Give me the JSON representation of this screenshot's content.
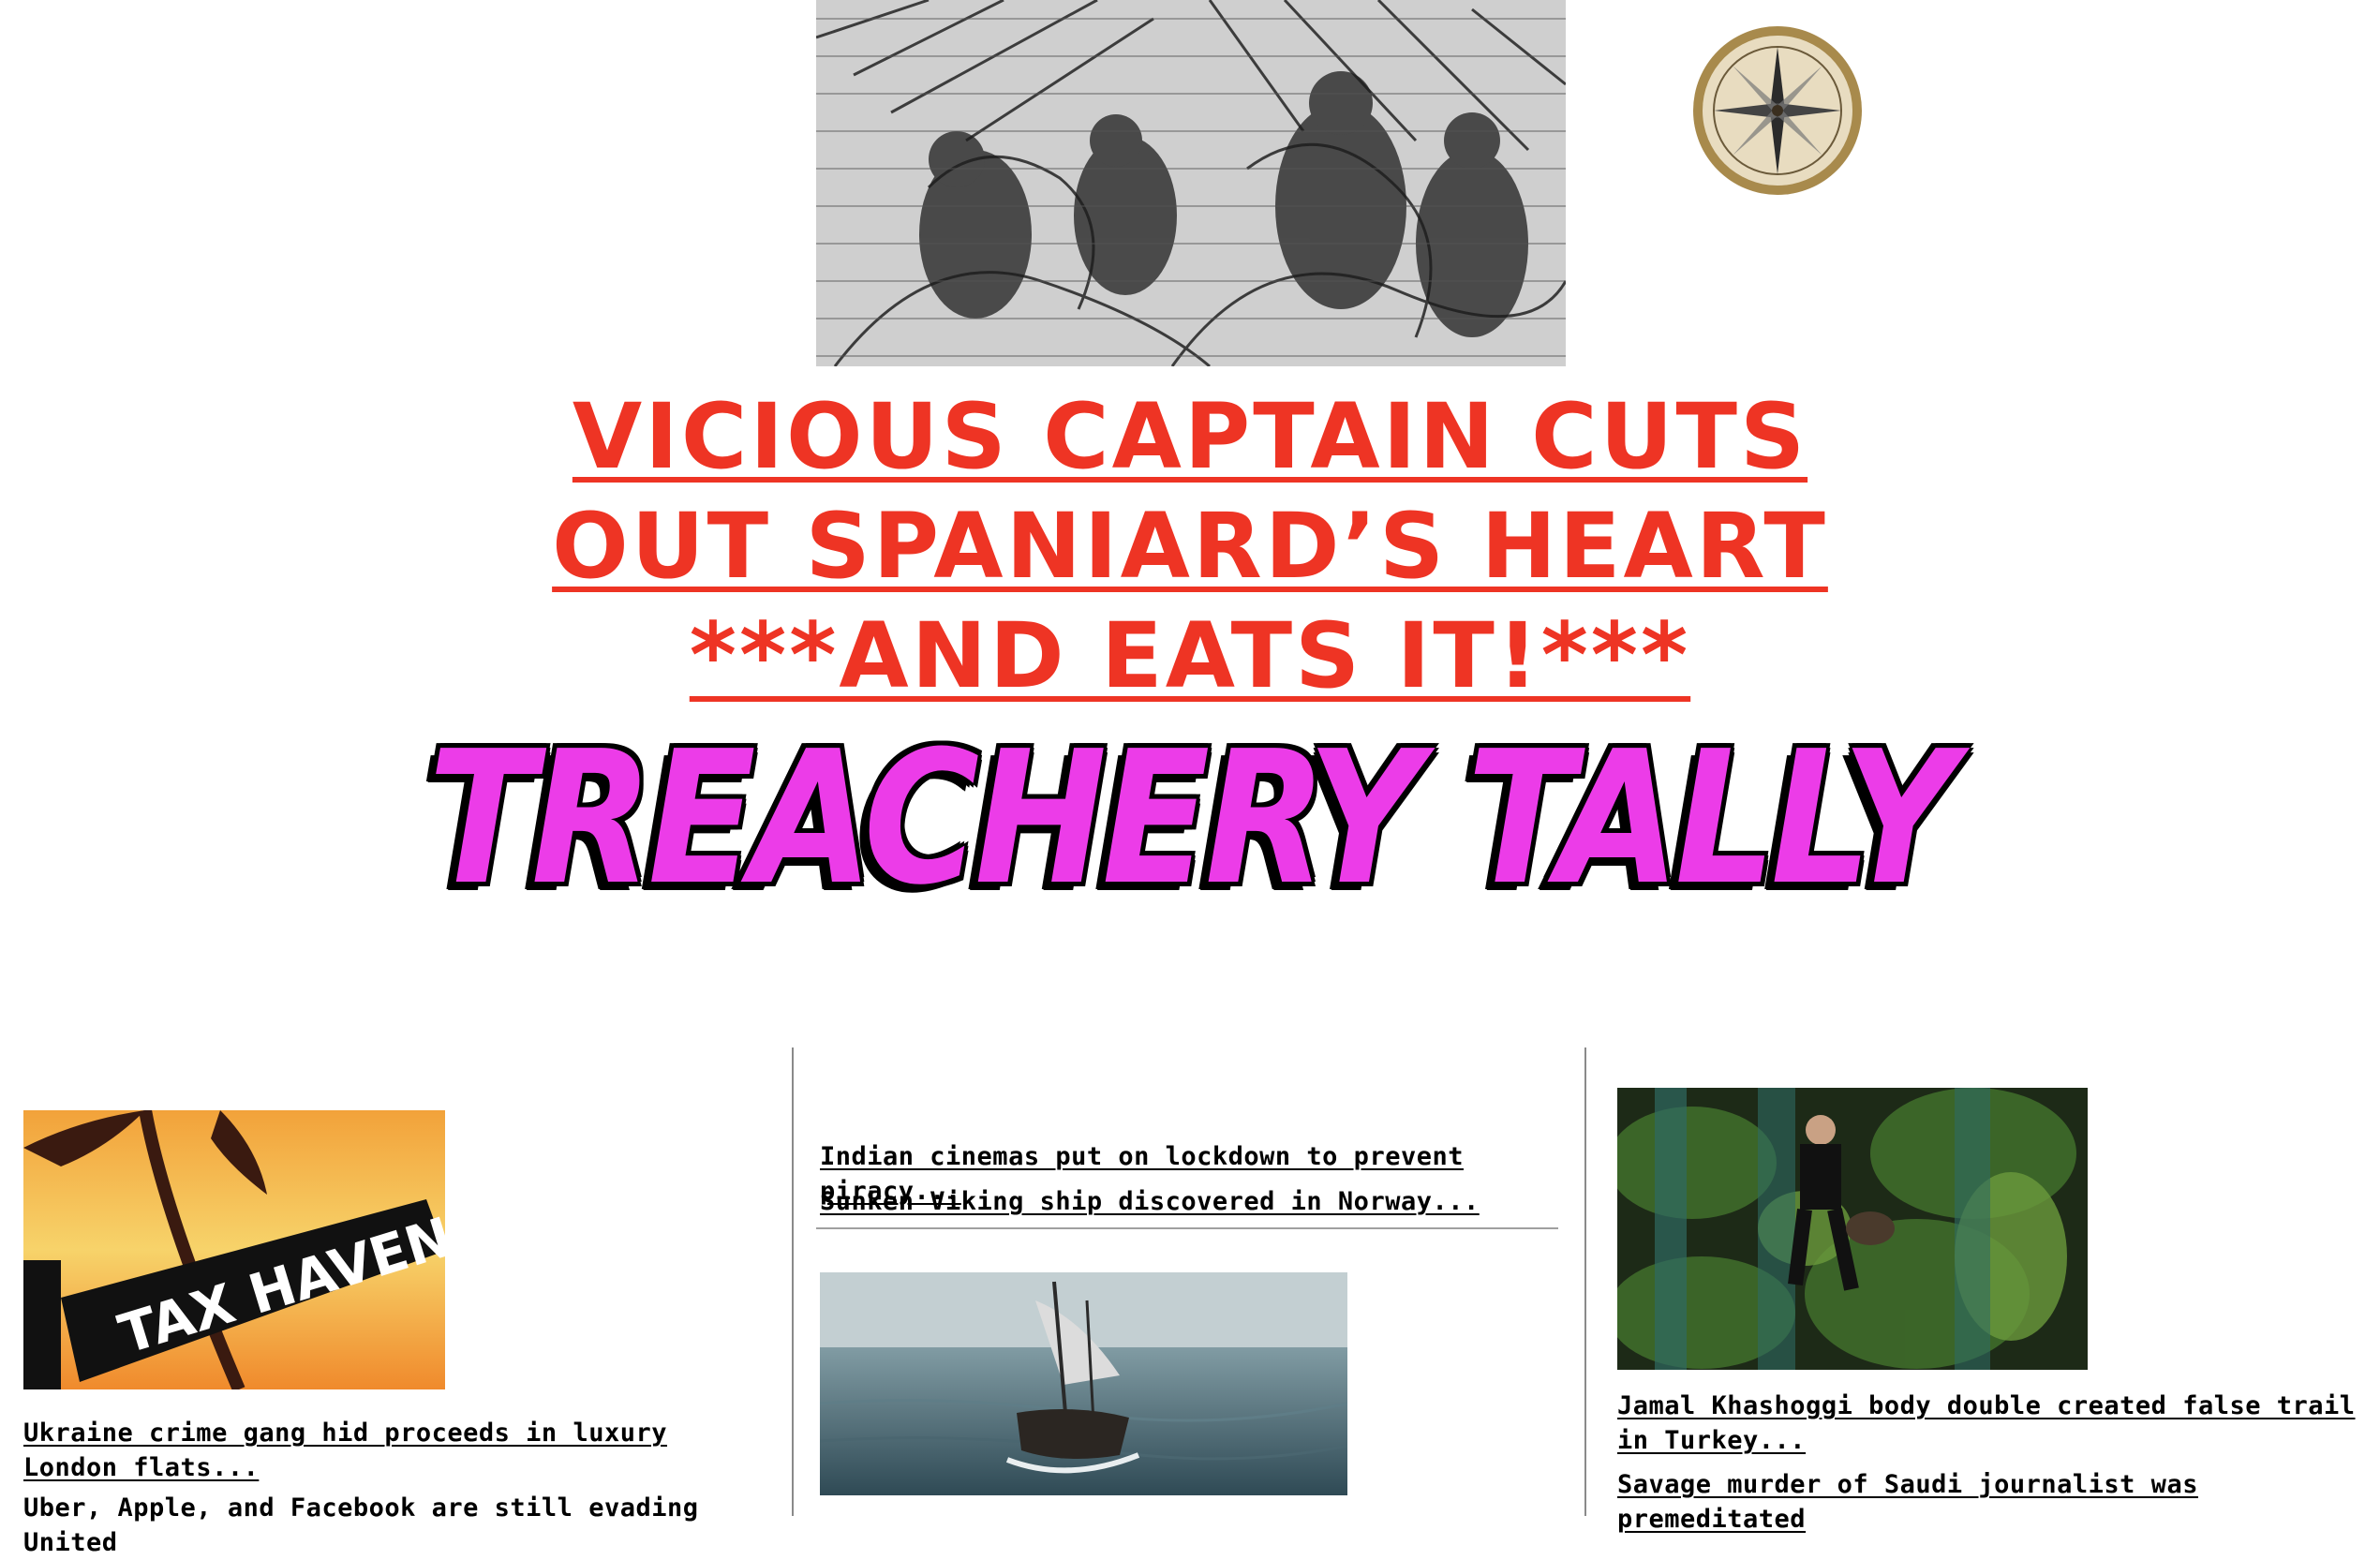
{
  "header": {
    "headline_lines": [
      "VICIOUS CAPTAIN CUTS",
      "OUT SPANIARD’S HEART",
      "***AND EATS IT!***"
    ],
    "masthead": "TREACHERY TALLY",
    "engraving_icon": "pirate-battle-engraving",
    "compass_icon": "compass-icon"
  },
  "columns": {
    "left": {
      "image_sign_text": "TAX HAVEN",
      "links": [
        "Ukraine crime gang hid proceeds in luxury London flats...",
        "Uber, Apple, and Facebook are still evading United"
      ]
    },
    "center": {
      "links": [
        "Indian cinemas put on lockdown to prevent piracy...",
        "Sunken Viking ship discovered in Norway..."
      ]
    },
    "right": {
      "links": [
        "Jamal Khashoggi body double created false trail in Turkey...",
        "Savage murder of Saudi journalist was premeditated"
      ]
    }
  },
  "colors": {
    "headline": "#ee3424",
    "masthead": "#ec3ce8",
    "divider": "#8a8a8a"
  }
}
